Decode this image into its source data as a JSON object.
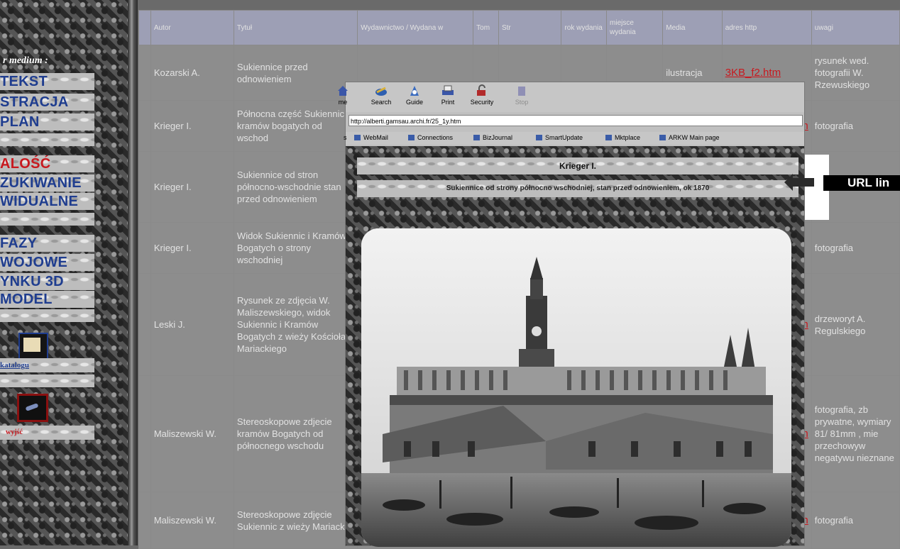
{
  "sidebar": {
    "section_label": "r medium :",
    "buttons": [
      {
        "label": "TEKST",
        "color": "#1f3d8f"
      },
      {
        "label": "STRACJA",
        "color": "#1f3d8f"
      },
      {
        "label": " PLAN",
        "color": "#1f3d8f"
      },
      {
        "label": "ALOŚĆ",
        "color": "#c8191f"
      },
      {
        "label": "ZUKIWANIE",
        "color": "#1f3d8f"
      },
      {
        "label": "WIDUALNE",
        "color": "#1f3d8f"
      },
      {
        "label": " FAZY",
        "color": "#1f3d8f"
      },
      {
        "label": "WOJOWE",
        "color": "#1f3d8f"
      },
      {
        "label": "YNKU 3D",
        "color": "#1f3d8f"
      },
      {
        "label": "MODEL",
        "color": "#1f3d8f"
      }
    ],
    "catalog_label": "katalogu",
    "exit_label": "wyjść"
  },
  "table": {
    "headers": [
      "",
      "Autor",
      "Tytuł",
      "Wydawnictwo / Wydana w",
      "Tom",
      "Str",
      "rok wydania",
      "miejsce wydania",
      "Media",
      "adres http",
      "uwagi"
    ],
    "rows": [
      {
        "autor": "Kozarski A.",
        "tytul": "Sukiennice przed odnowieniem",
        "media": "ilustracja",
        "adres": "3KB_f2.htm",
        "uwagi": "rysunek wed. fotografii W. Rzewuskiego"
      },
      {
        "autor": "Krieger I.",
        "tytul": "Północna część Sukiennic i kramów bogatych od wschod",
        "media": "",
        "adres": "m",
        "uwagi": "fotografia"
      },
      {
        "autor": "Krieger I.",
        "tytul": "Sukiennice od stron północno-wschodnie stan przed odnowieniem",
        "media": "",
        "adres": "",
        "uwagi": ""
      },
      {
        "autor": "Krieger I.",
        "tytul": "Widok Sukiennic i Kramów Bogatych o strony wschodniej",
        "media": "",
        "adres": "",
        "uwagi": "fotografia"
      },
      {
        "autor": "Leski J.",
        "tytul": "Rysunek ze zdjęcia W. Maliszewskiego, widok Sukiennic i Kramów Bogatych z wieży Kościoła Mariackiego",
        "media": "",
        "adres": "tm",
        "uwagi": "drzeworyt A. Regulskiego"
      },
      {
        "autor": "Maliszewski W.",
        "tytul": "Stereoskopowe zdjecie kramów Bogatych od północnego wschodu",
        "media": "",
        "adres": "m",
        "uwagi": "fotografia, zb prywatne, wymiary 81/ 81mm , mie przechowyw negatywu nieznane"
      },
      {
        "autor": "Maliszewski W.",
        "tytul": "Stereoskopowe zdjęcie Sukiennic z wieży Mariackiej",
        "media": "",
        "adres": "stm",
        "uwagi": "fotografia"
      }
    ]
  },
  "popup": {
    "toolbar": [
      {
        "label": "me",
        "icon": "home-icon"
      },
      {
        "label": "Search",
        "icon": "search-icon"
      },
      {
        "label": "Guide",
        "icon": "guide-icon"
      },
      {
        "label": "Print",
        "icon": "print-icon"
      },
      {
        "label": "Security",
        "icon": "security-icon"
      },
      {
        "label": "Stop",
        "icon": "stop-icon"
      }
    ],
    "address": "http://alberti.gamsau.archi.fr/25_1y.htm",
    "personal_bar": [
      "WebMail",
      "Connections",
      "BizJournal",
      "SmartUpdate",
      "Mktplace",
      "ARKW Main page"
    ],
    "caption_author": "Krieger I.",
    "caption_title": "Sukiennice od strony północno wschodniej, stan przed odnowieniem, ok 1870"
  },
  "overlay": {
    "url_label": "URL lin"
  }
}
